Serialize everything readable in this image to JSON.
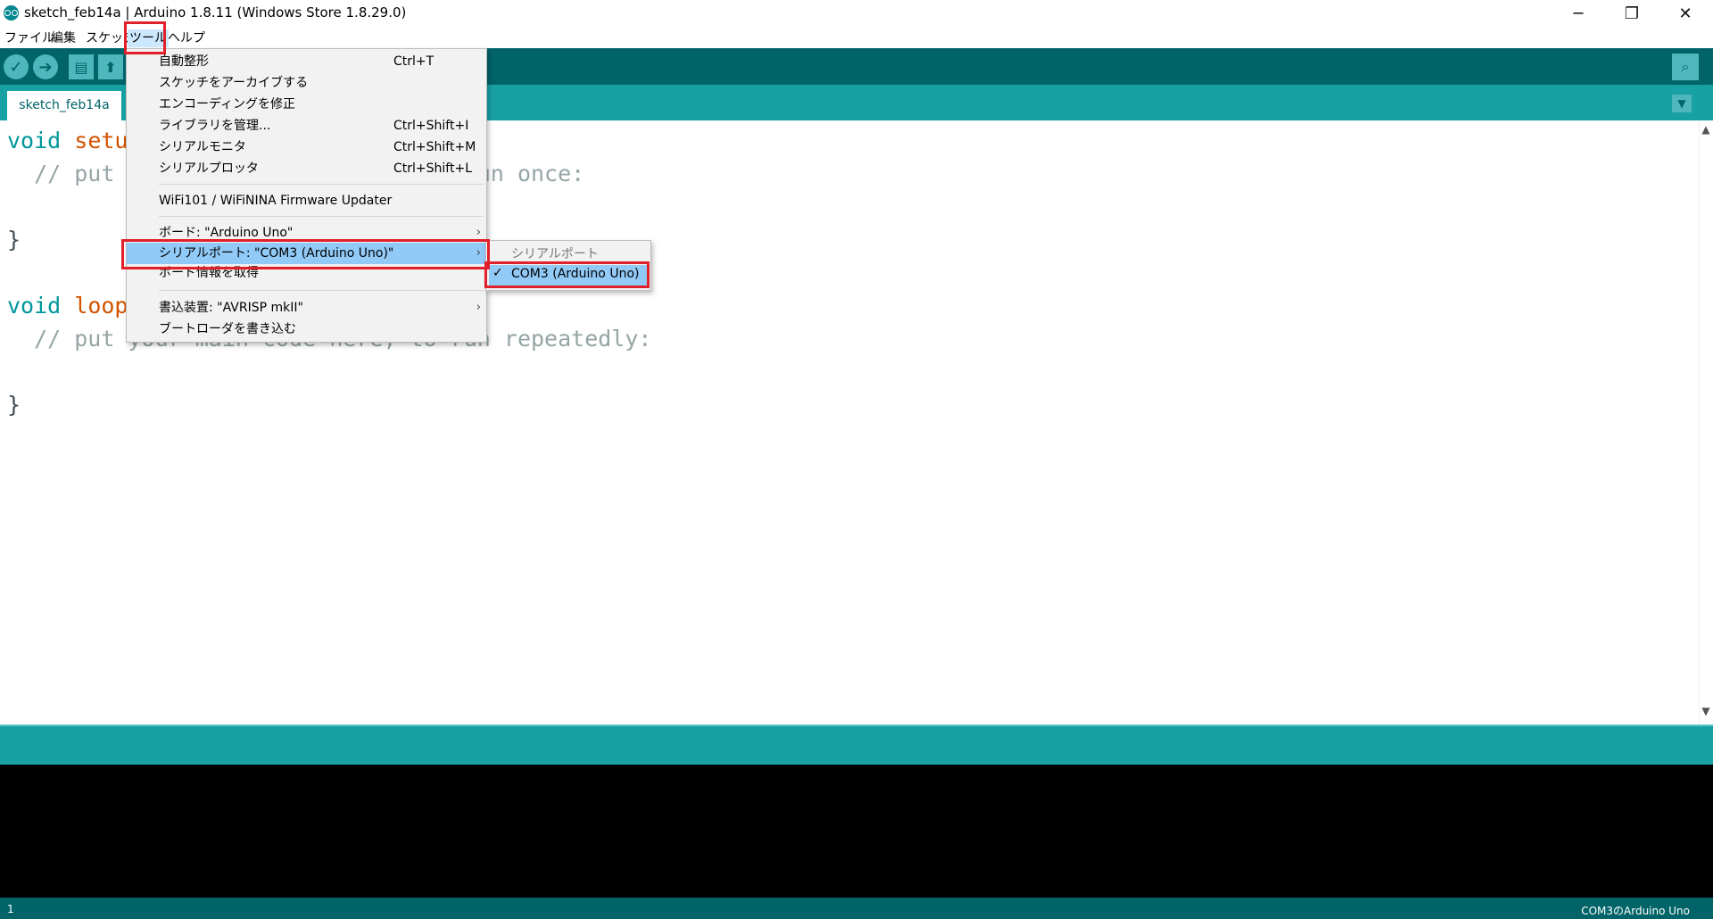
{
  "window": {
    "title": "sketch_feb14a | Arduino 1.8.11 (Windows Store 1.8.29.0)",
    "minimize_glyph": "─",
    "maximize_glyph": "❐",
    "close_glyph": "✕"
  },
  "menubar": {
    "file": "ファイル",
    "edit": "編集",
    "sketch": "スケッチ",
    "tools": "ツール",
    "help": "ヘルプ"
  },
  "toolbar": {
    "verify_icon": "✓",
    "upload_icon": "➔",
    "new_icon": "▤",
    "open_icon": "⬆",
    "serial_monitor_icon": "⌕"
  },
  "tabs": [
    {
      "label": "sketch_feb14a"
    }
  ],
  "tab_menu_icon": "▼",
  "editor": {
    "lines": [
      {
        "kw": "void",
        "fn": "setup",
        "rest": "() {"
      },
      {
        "comment": "  // put your setup code here, to run once:"
      },
      {
        "text": ""
      },
      {
        "text": "}"
      },
      {
        "text": ""
      },
      {
        "kw": "void",
        "fn": "loop",
        "rest": "() {"
      },
      {
        "comment": "  // put your main code here, to run repeatedly:"
      },
      {
        "text": ""
      },
      {
        "text": "}"
      }
    ]
  },
  "tools_menu": {
    "items": [
      {
        "label": "自動整形",
        "shortcut": "Ctrl+T"
      },
      {
        "label": "スケッチをアーカイブする",
        "shortcut": ""
      },
      {
        "label": "エンコーディングを修正",
        "shortcut": ""
      },
      {
        "label": "ライブラリを管理...",
        "shortcut": "Ctrl+Shift+I"
      },
      {
        "label": "シリアルモニタ",
        "shortcut": "Ctrl+Shift+M"
      },
      {
        "label": "シリアルプロッタ",
        "shortcut": "Ctrl+Shift+L"
      },
      {
        "label": "WiFi101 / WiFiNINA Firmware Updater",
        "shortcut": ""
      },
      {
        "label": "ボード: \"Arduino Uno\"",
        "shortcut": ""
      },
      {
        "label": "シリアルポート: \"COM3 (Arduino Uno)\"",
        "shortcut": ""
      },
      {
        "label": "ボード情報を取得",
        "shortcut": ""
      },
      {
        "label": "書込装置: \"AVRISP mkII\"",
        "shortcut": ""
      },
      {
        "label": "ブートローダを書き込む",
        "shortcut": ""
      }
    ],
    "submenu_arrow": "›"
  },
  "port_submenu": {
    "header": "シリアルポート",
    "check": "✓",
    "selected": "COM3 (Arduino Uno)"
  },
  "status": {
    "line": "1",
    "board": "COM3のArduino Uno"
  },
  "colors": {
    "toolbar": "#006468",
    "tabbar": "#17a1a5",
    "menu_highlight": "#91c9f7",
    "annotation_red": "#e0202a"
  }
}
